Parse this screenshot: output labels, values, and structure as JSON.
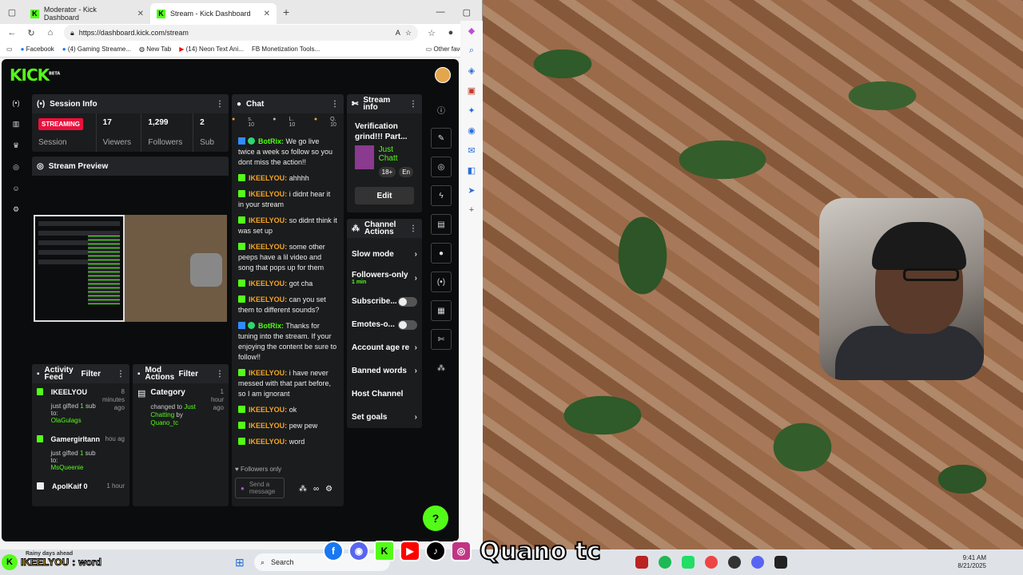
{
  "browser": {
    "tabs": [
      {
        "label": "Moderator - Kick Dashboard"
      },
      {
        "label": "Stream - Kick Dashboard"
      }
    ],
    "url": "https://dashboard.kick.com/stream",
    "bookmarks": [
      "Facebook",
      "(4) Gaming Streame...",
      "New Tab",
      "(14) Neon Text Ani...",
      "Monetization Tools...",
      "Other favorites"
    ],
    "bookmark_prefix_fb": "FB"
  },
  "kick": {
    "brand": "KICK",
    "brand_tag": "BETA",
    "session": {
      "title": "Session Info",
      "status": "STREAMING",
      "status_label": "Session",
      "viewers_value": "17",
      "viewers_label": "Viewers",
      "followers_value": "1,299",
      "followers_label": "Followers",
      "subs_value": "2",
      "subs_label": "Sub"
    },
    "preview_title": "Stream Preview",
    "chat": {
      "title": "Chat",
      "stat_s": "s. 10",
      "stat_l": "L. 10",
      "stat_q": "Q. 10",
      "messages": [
        {
          "user": "BotRix:",
          "text": " We go live twice a week so follow so you dont miss the action!!"
        },
        {
          "user": "IKEELYOU:",
          "text": " ahhhh"
        },
        {
          "user": "IKEELYOU:",
          "text": " i didnt hear it in your stream"
        },
        {
          "user": "IKEELYOU:",
          "text": " so didnt think it was set up"
        },
        {
          "user": "IKEELYOU:",
          "text": " some other peeps have a lil video and song that pops up for them"
        },
        {
          "user": "IKEELYOU:",
          "text": " got cha"
        },
        {
          "user": "IKEELYOU:",
          "text": " can you set them to different sounds?"
        },
        {
          "user": "BotRix:",
          "text": " Thanks for tuning into the stream. If your enjoying the content be sure to follow!!"
        },
        {
          "user": "IKEELYOU:",
          "text": " i have never messed with that part before, so I am ignorant"
        },
        {
          "user": "IKEELYOU:",
          "text": " ok"
        },
        {
          "user": "IKEELYOU:",
          "text": " pew pew"
        },
        {
          "user": "IKEELYOU:",
          "text": " word"
        }
      ],
      "mode_note": "Followers only",
      "input_placeholder": "Send a message"
    },
    "stream_info": {
      "title": "Stream info",
      "stream_title": "Verification grind!!! Part...",
      "category": "Just Chatt",
      "tag1": "18+",
      "tag2": "En",
      "edit_label": "Edit"
    },
    "channel_actions": {
      "title": "Channel Actions",
      "items": [
        {
          "label": "Slow mode"
        },
        {
          "label": "Followers-only",
          "sub": "1 min"
        },
        {
          "label": "Subscribe..."
        },
        {
          "label": "Emotes-o..."
        },
        {
          "label": "Account age re"
        },
        {
          "label": "Banned words"
        },
        {
          "label": "Host Channel"
        },
        {
          "label": "Set goals"
        }
      ]
    },
    "activity": {
      "title": "Activity Feed",
      "filter": "Filter",
      "items": [
        {
          "name": "IKEELYOU",
          "pre": "just gifted ",
          "count": "1",
          "post": " sub to:",
          "target": "OlaGulags",
          "time": "8 minutes ago"
        },
        {
          "name": "Gamergirltann",
          "pre": "just gifted ",
          "count": "1",
          "post": " sub to:",
          "target": "MsQueenie",
          "time": "hou ag"
        },
        {
          "name": "ApolKaif 0",
          "time": "1 hour"
        }
      ]
    },
    "mod_actions": {
      "title": "Mod Actions",
      "filter": "Filter",
      "item_title": "Category",
      "item_time": "1 hour ago",
      "item_pre": "changed to ",
      "item_value": "Just Chatting",
      "item_by": " by ",
      "item_user": "Quano_tc"
    }
  },
  "overlay": {
    "name": "Quano tc",
    "chat_user": "IKEELYOU",
    "chat_sep": ":",
    "chat_msg": "word",
    "weather": "Rainy days ahead"
  },
  "taskbar": {
    "search": "Search",
    "time": "9:41 AM",
    "date": "8/21/2025"
  }
}
